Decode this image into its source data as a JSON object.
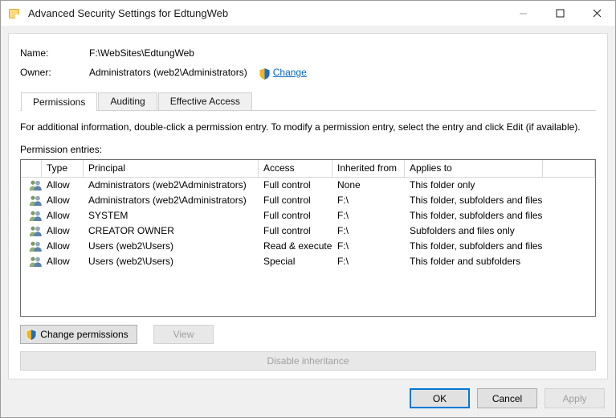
{
  "window": {
    "title": "Advanced Security Settings for EdtungWeb",
    "icon": "folder-icon",
    "controls": {
      "minimize": "minimize-icon",
      "maximize": "maximize-icon",
      "close": "close-icon"
    }
  },
  "header": {
    "name_label": "Name:",
    "name_value": "F:\\WebSites\\EdtungWeb",
    "owner_label": "Owner:",
    "owner_value": "Administrators (web2\\Administrators)",
    "change_link": "Change",
    "change_shield_icon": "uac-shield-icon"
  },
  "tabs": [
    {
      "label": "Permissions",
      "active": true
    },
    {
      "label": "Auditing",
      "active": false
    },
    {
      "label": "Effective Access",
      "active": false
    }
  ],
  "main": {
    "info_text": "For additional information, double-click a permission entry. To modify a permission entry, select the entry and click Edit (if available).",
    "entries_label": "Permission entries:",
    "columns": [
      "Type",
      "Principal",
      "Access",
      "Inherited from",
      "Applies to"
    ],
    "rows": [
      {
        "icon": "users-group-icon",
        "type": "Allow",
        "principal": "Administrators (web2\\Administrators)",
        "access": "Full control",
        "inherited_from": "None",
        "applies_to": "This folder only"
      },
      {
        "icon": "users-group-icon",
        "type": "Allow",
        "principal": "Administrators (web2\\Administrators)",
        "access": "Full control",
        "inherited_from": "F:\\",
        "applies_to": "This folder, subfolders and files"
      },
      {
        "icon": "users-group-icon",
        "type": "Allow",
        "principal": "SYSTEM",
        "access": "Full control",
        "inherited_from": "F:\\",
        "applies_to": "This folder, subfolders and files"
      },
      {
        "icon": "users-group-icon",
        "type": "Allow",
        "principal": "CREATOR OWNER",
        "access": "Full control",
        "inherited_from": "F:\\",
        "applies_to": "Subfolders and files only"
      },
      {
        "icon": "users-group-icon",
        "type": "Allow",
        "principal": "Users (web2\\Users)",
        "access": "Read & execute",
        "inherited_from": "F:\\",
        "applies_to": "This folder, subfolders and files"
      },
      {
        "icon": "users-group-icon",
        "type": "Allow",
        "principal": "Users (web2\\Users)",
        "access": "Special",
        "inherited_from": "F:\\",
        "applies_to": "This folder and subfolders"
      }
    ]
  },
  "actions": {
    "change_permissions": "Change permissions",
    "change_permissions_shield_icon": "uac-shield-icon",
    "view": "View",
    "disable_inheritance": "Disable inheritance"
  },
  "footer": {
    "ok": "OK",
    "cancel": "Cancel",
    "apply": "Apply"
  },
  "colors": {
    "accent": "#0078d7",
    "link": "#0066cc",
    "dialog_bg": "#f0f0f0",
    "panel_bg": "#ffffff",
    "disabled_text": "#a0a0a0"
  }
}
